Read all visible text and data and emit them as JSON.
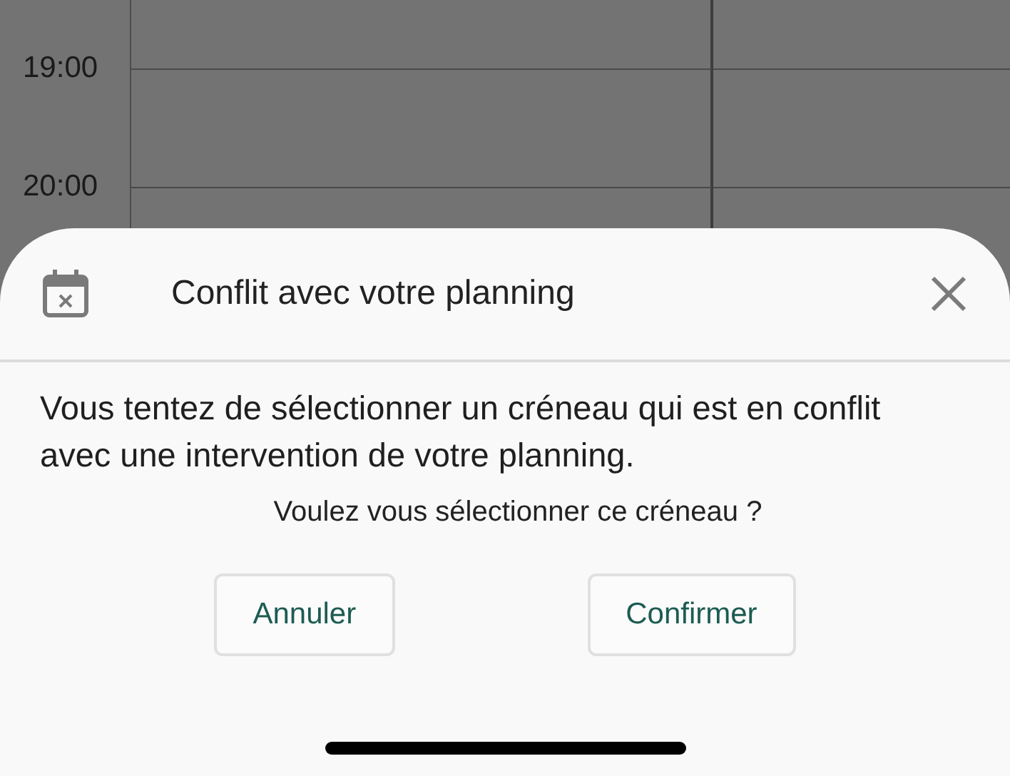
{
  "calendar": {
    "hours": [
      "19:00",
      "20:00"
    ]
  },
  "dialog": {
    "title": "Conflit avec votre planning",
    "message": "Vous tentez de sélectionner un créneau qui est en conflit avec une intervention de votre planning.",
    "question": "Voulez vous sélectionner ce créneau ?",
    "buttons": [
      {
        "label": "Annuler"
      },
      {
        "label": "Confirmer"
      }
    ]
  }
}
